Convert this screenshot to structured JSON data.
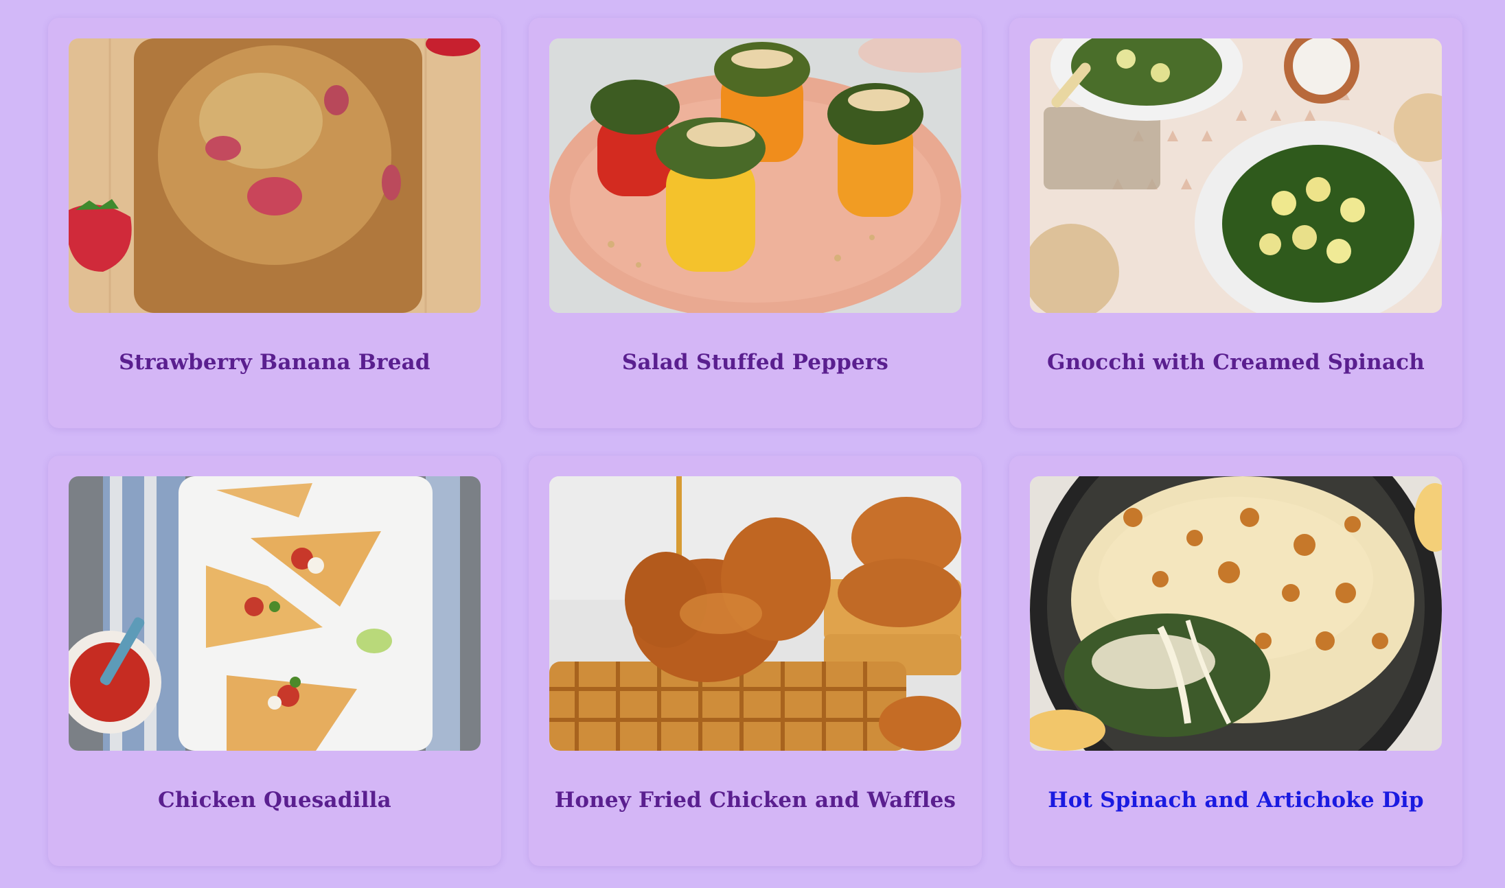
{
  "colors": {
    "background": "#d2b8f8",
    "card": "#d4b6f6",
    "title": "#5a1f8f",
    "title_hover": "#1a1ae0"
  },
  "recipes": [
    {
      "title": "Strawberry Banana Bread",
      "image": "strawberry-banana-bread-photo"
    },
    {
      "title": "Salad Stuffed Peppers",
      "image": "salad-stuffed-peppers-photo"
    },
    {
      "title": "Gnocchi with Creamed Spinach",
      "image": "gnocchi-creamed-spinach-photo"
    },
    {
      "title": "Chicken Quesadilla",
      "image": "chicken-quesadilla-photo"
    },
    {
      "title": "Honey Fried Chicken and Waffles",
      "image": "honey-fried-chicken-waffles-photo"
    },
    {
      "title": "Hot Spinach and Artichoke Dip",
      "image": "spinach-artichoke-dip-photo",
      "hovered": true
    }
  ]
}
